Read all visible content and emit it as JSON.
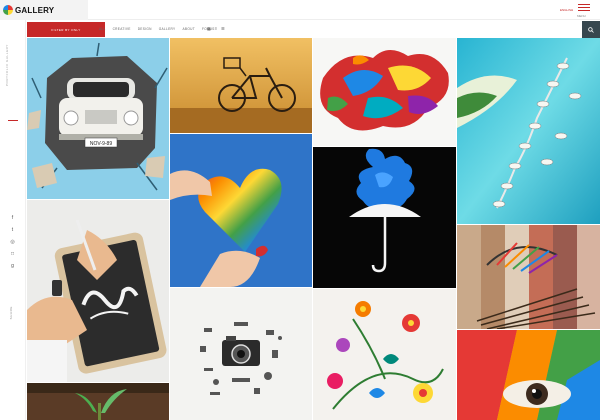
{
  "header": {
    "logo_text": "GALLERY",
    "lang": "ENGLISH",
    "menu_label": "MENU"
  },
  "sidebar": {
    "vertical_text": "PORTFOLIO GALLERY",
    "share_label": "SHARE",
    "socials": [
      {
        "icon": "facebook-icon",
        "glyph": "f"
      },
      {
        "icon": "twitter-icon",
        "glyph": "t"
      },
      {
        "icon": "dribbble-icon",
        "glyph": "◎"
      },
      {
        "icon": "instagram-icon",
        "glyph": "□"
      },
      {
        "icon": "google-plus-icon",
        "glyph": "g"
      }
    ]
  },
  "nav": {
    "button_label": "FILTER BY ONLY",
    "items": [
      "ALL",
      "CREATIVE",
      "DESIGN",
      "GALLERY",
      "ABOUT",
      "FOCUS"
    ],
    "icons": [
      "grid-icon",
      "list-icon",
      "menu-icon"
    ]
  },
  "colors": {
    "accent": "#c62828",
    "search_bg": "#37474f"
  },
  "gallery": {
    "tiles": [
      "car-through-wall",
      "bicycle-sunset",
      "color-splash",
      "tropical-island",
      "tablet-drawing",
      "rainbow-heart",
      "umbrella-smoke",
      "paint-brushes",
      "plant-sprout",
      "camera-parts",
      "paper-quilling",
      "rainbow-eye"
    ]
  }
}
